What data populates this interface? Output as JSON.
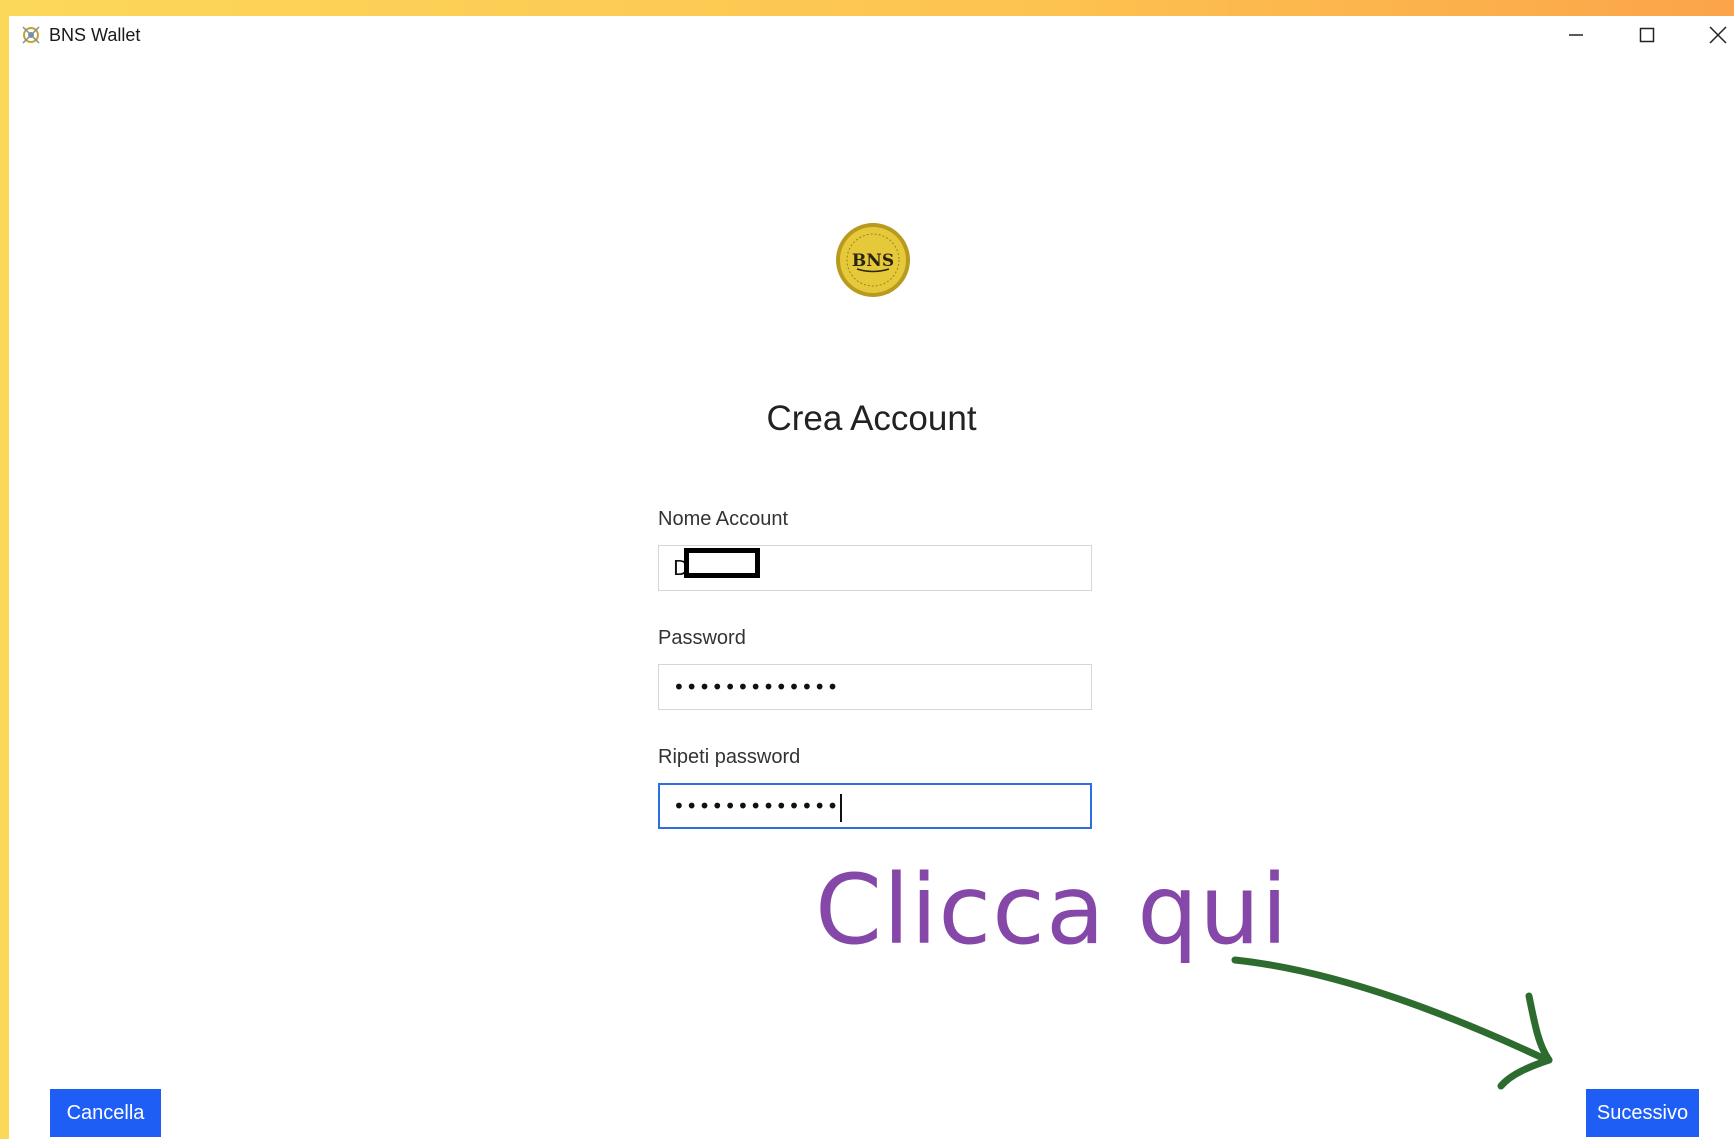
{
  "window": {
    "title": "BNS Wallet",
    "controls": {
      "minimize_icon": "minimize-icon",
      "maximize_icon": "maximize-icon",
      "close_icon": "close-icon"
    }
  },
  "logo": {
    "icon": "bns-coin-logo",
    "text": "BNS"
  },
  "form": {
    "title": "Crea Account",
    "account_name": {
      "label": "Nome Account",
      "value": "D"
    },
    "password": {
      "label": "Password",
      "value": "•••••••••••••"
    },
    "repeat_password": {
      "label": "Ripeti password",
      "value": "•••••••••••••"
    }
  },
  "buttons": {
    "cancel_label": "Cancella",
    "next_label": "Sucessivo"
  },
  "annotation": {
    "text": "Clicca qui",
    "color": "#8548a8",
    "arrow_color": "#2e6b2e"
  },
  "colors": {
    "primary_button": "#1e5ef5",
    "focus_border": "#2b6fe0"
  }
}
